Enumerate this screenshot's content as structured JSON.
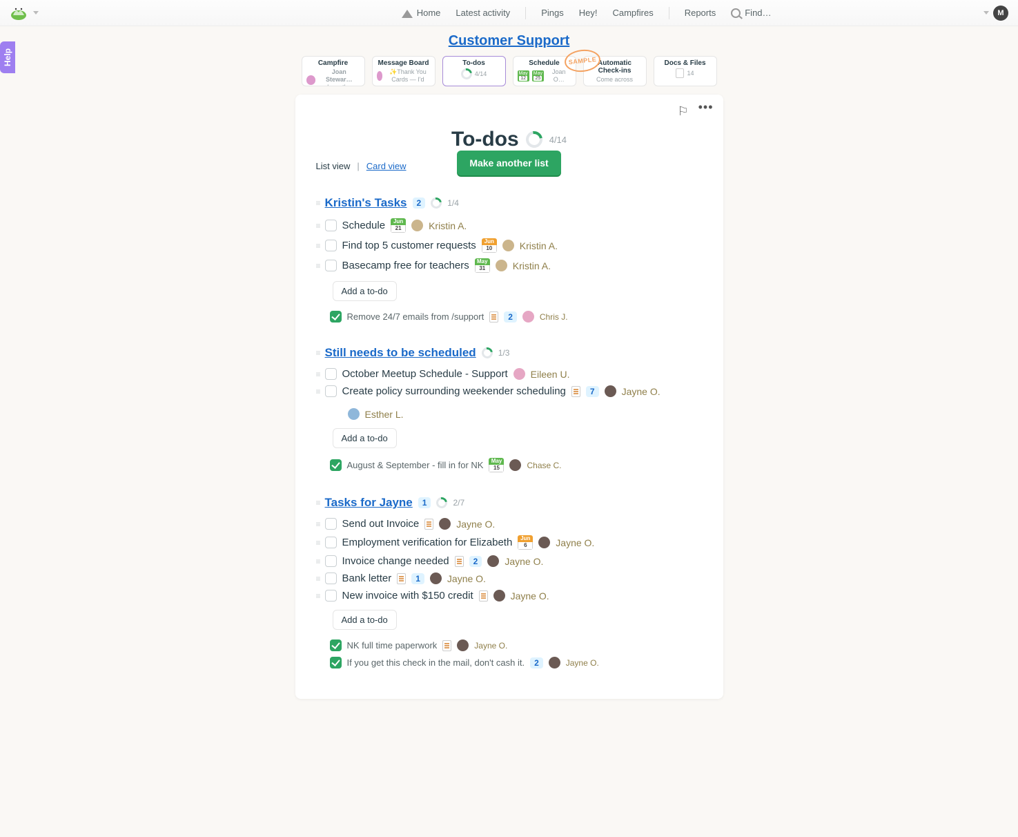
{
  "nav": {
    "home": "Home",
    "latest": "Latest activity",
    "pings": "Pings",
    "hey": "Hey!",
    "campfires": "Campfires",
    "reports": "Reports",
    "find": "Find…",
    "user_initial": "M"
  },
  "project": {
    "title": "Customer Support",
    "sample": "SAMPLE"
  },
  "help_tab": "Help",
  "tools": {
    "campfire": {
      "title": "Campfire",
      "who": "Joan Stewar…",
      "sub": "I use the"
    },
    "message_board": {
      "title": "Message Board",
      "sub": "✨Thank You Cards — I'd"
    },
    "todos": {
      "title": "To-dos",
      "count": "4/14"
    },
    "schedule": {
      "title": "Schedule",
      "d1m": "May",
      "d1d": "12",
      "d2m": "May",
      "d2d": "25",
      "who": "Joan O…"
    },
    "checkins": {
      "title": "Automatic Check-ins",
      "sub": "Come across any…"
    },
    "docs": {
      "title": "Docs & Files",
      "sub": "14"
    }
  },
  "sheet": {
    "title": "To-dos",
    "count": "4/14",
    "list_view": "List view",
    "card_view": "Card view",
    "make_list": "Make another list"
  },
  "lists": {
    "kristin": {
      "title": "Kristin's Tasks",
      "comments": "2",
      "count": "1/4",
      "add": "Add a to-do",
      "items": [
        {
          "title": "Schedule",
          "date_m": "Jun",
          "date_d": "21",
          "assignee": "Kristin A."
        },
        {
          "title": "Find top 5 customer requests",
          "date_m": "Jun",
          "date_d": "10",
          "date_color": "orange",
          "assignee": "Kristin A."
        },
        {
          "title": "Basecamp free for teachers",
          "date_m": "May",
          "date_d": "31",
          "assignee": "Kristin A."
        }
      ],
      "done": [
        {
          "title": "Remove 24/7 emails from /support",
          "comments": "2",
          "assignee": "Chris J."
        }
      ]
    },
    "scheduled": {
      "title": "Still needs to be scheduled",
      "count": "1/3",
      "add": "Add a to-do",
      "items": [
        {
          "title": "October Meetup Schedule - Support",
          "assignee": "Eileen U."
        },
        {
          "title": "Create policy surrounding weekender scheduling",
          "comments": "7",
          "assignee": "Jayne O.",
          "extra_assignee": "Esther L."
        }
      ],
      "done": [
        {
          "title": "August & September - fill in for NK",
          "date_m": "May",
          "date_d": "15",
          "assignee": "Chase C."
        }
      ]
    },
    "jayne": {
      "title": "Tasks for Jayne",
      "comments": "1",
      "count": "2/7",
      "add": "Add a to-do",
      "items": [
        {
          "title": "Send out Invoice",
          "doc": true,
          "assignee": "Jayne O."
        },
        {
          "title": "Employment verification for Elizabeth",
          "date_m": "Jun",
          "date_d": "6",
          "date_color": "orange",
          "assignee": "Jayne O."
        },
        {
          "title": "Invoice change needed",
          "doc": true,
          "comments": "2",
          "assignee": "Jayne O."
        },
        {
          "title": "Bank letter",
          "doc": true,
          "comments": "1",
          "assignee": "Jayne O."
        },
        {
          "title": "New invoice with $150 credit",
          "doc": true,
          "assignee": "Jayne O."
        }
      ],
      "done": [
        {
          "title": "NK full time paperwork",
          "doc": true,
          "assignee": "Jayne O."
        },
        {
          "title": "If you get this check in the mail, don't cash it.",
          "comments": "2",
          "assignee": "Jayne O."
        }
      ]
    }
  }
}
